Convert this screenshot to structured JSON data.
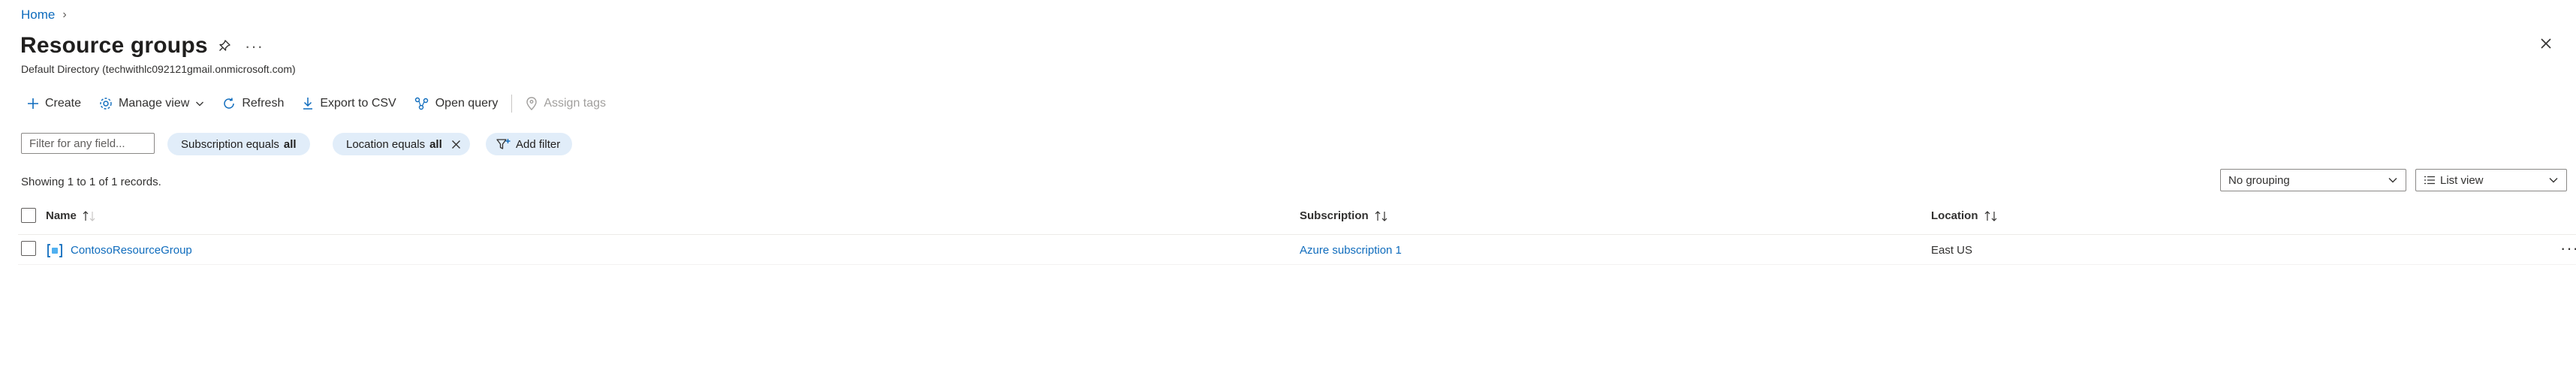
{
  "breadcrumb": {
    "home": "Home",
    "separator": "›"
  },
  "header": {
    "title": "Resource groups",
    "more": "···",
    "subtitle": "Default Directory (techwithlc092121gmail.onmicrosoft.com)"
  },
  "toolbar": {
    "create": "Create",
    "manage_view": "Manage view",
    "refresh": "Refresh",
    "export_csv": "Export to CSV",
    "open_query": "Open query",
    "assign_tags": "Assign tags"
  },
  "filters": {
    "search_placeholder": "Filter for any field...",
    "subscription_label": "Subscription equals ",
    "subscription_value": "all",
    "location_label": "Location equals ",
    "location_value": "all",
    "add_filter": "Add filter"
  },
  "records_text": "Showing 1 to 1 of 1 records.",
  "grouping": {
    "selected": "No grouping"
  },
  "view": {
    "selected": "List view"
  },
  "table": {
    "columns": {
      "name": "Name",
      "subscription": "Subscription",
      "location": "Location"
    },
    "rows": [
      {
        "name": "ContosoResourceGroup",
        "subscription": "Azure subscription 1",
        "location": "East US"
      }
    ],
    "row_more": "···"
  },
  "colors": {
    "accent": "#0f6cbd",
    "pill_bg": "#e1edf9",
    "text": "#323130"
  }
}
